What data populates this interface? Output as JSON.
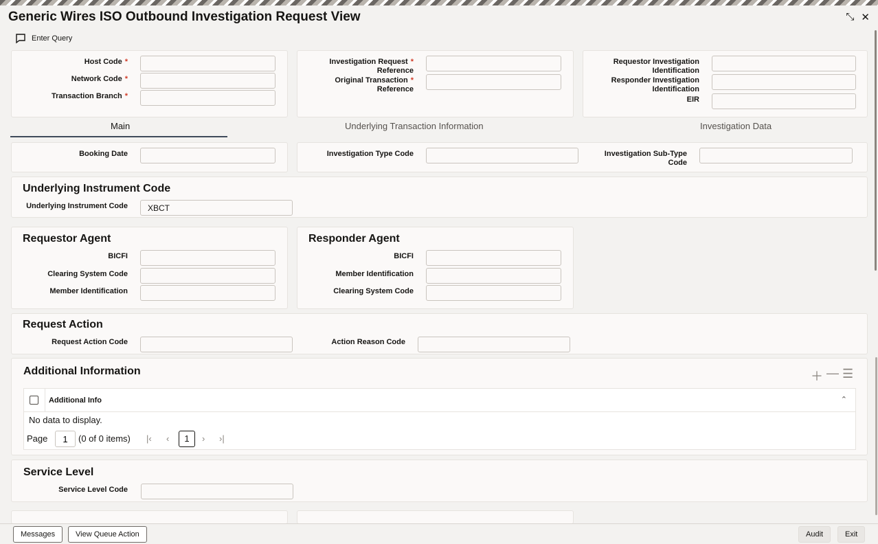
{
  "window": {
    "title": "Generic Wires ISO Outbound Investigation Request View"
  },
  "toolbar": {
    "enter_query": "Enter Query"
  },
  "header": {
    "host_code": {
      "label": "Host Code",
      "required": "*",
      "value": ""
    },
    "network_code": {
      "label": "Network Code",
      "required": "*",
      "value": ""
    },
    "transaction_branch": {
      "label": "Transaction Branch",
      "required": "*",
      "value": ""
    },
    "investigation_request_reference": {
      "label_1": "Investigation Request",
      "label_2": "Reference",
      "required": "*",
      "value": ""
    },
    "original_transaction_reference": {
      "label_1": "Original Transaction",
      "label_2": "Reference",
      "required": "*",
      "value": ""
    },
    "requestor_investigation_identification": {
      "label_1": "Requestor Investigation",
      "label_2": "Identification",
      "value": ""
    },
    "responder_investigation_identification": {
      "label_1": "Responder Investigation",
      "label_2": "Identification",
      "value": ""
    },
    "eir": {
      "label": "EIR",
      "value": ""
    }
  },
  "tabs": [
    {
      "label": "Main",
      "active": true
    },
    {
      "label": "Underlying Transaction Information",
      "active": false
    },
    {
      "label": "Investigation Data",
      "active": false
    }
  ],
  "main": {
    "booking_date": {
      "label": "Booking Date",
      "value": ""
    },
    "investigation_type_code": {
      "label": "Investigation Type Code",
      "value": ""
    },
    "investigation_sub_type_code": {
      "label": "Investigation Sub-Type Code",
      "value": ""
    },
    "underlying_instrument": {
      "title": "Underlying Instrument Code",
      "code_label": "Underlying Instrument Code",
      "code_value": "XBCT"
    },
    "requestor_agent": {
      "title": "Requestor Agent",
      "bicfi_label": "BICFI",
      "bicfi_value": "",
      "clearing_label": "Clearing System Code",
      "clearing_value": "",
      "member_label": "Member Identification",
      "member_value": ""
    },
    "responder_agent": {
      "title": "Responder Agent",
      "bicfi_label": "BICFI",
      "bicfi_value": "",
      "member_label": "Member Identification",
      "member_value": "",
      "clearing_label": "Clearing System Code",
      "clearing_value": ""
    },
    "request_action": {
      "title": "Request Action",
      "code_label": "Request Action Code",
      "code_value": "",
      "reason_label": "Action Reason Code",
      "reason_value": ""
    },
    "additional_information": {
      "title": "Additional Information",
      "column": "Additional Info",
      "empty": "No data to display.",
      "page_label": "Page",
      "page_value": "1",
      "count": "(0 of 0 items)",
      "current_page": "1"
    },
    "service_level": {
      "title": "Service Level",
      "code_label": "Service Level Code",
      "code_value": ""
    }
  },
  "footer": {
    "messages": "Messages",
    "view_queue_action": "View Queue Action",
    "audit": "Audit",
    "exit": "Exit"
  },
  "icons": {
    "chat": "chat-bubble-icon",
    "minimize": "collapse-icon",
    "close": "close-icon",
    "add": "plus-icon",
    "remove": "minus-icon",
    "columns": "list-settings-icon",
    "sort": "sort-icon"
  }
}
